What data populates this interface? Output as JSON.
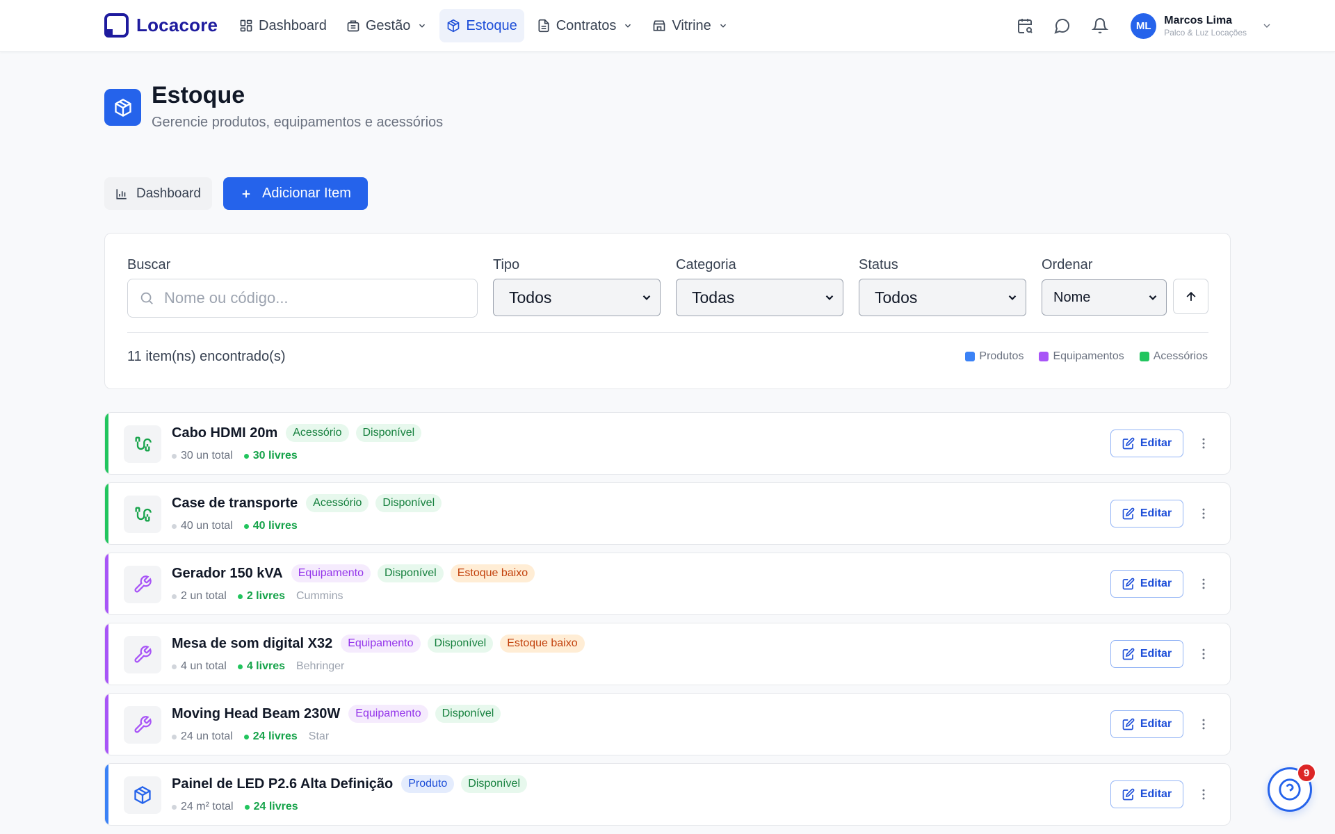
{
  "brand": {
    "name": "Locacore",
    "color": "#1e1b9e"
  },
  "nav": [
    {
      "label": "Dashboard",
      "icon": "grid-icon",
      "dropdown": false,
      "active": false
    },
    {
      "label": "Gestão",
      "icon": "building-icon",
      "dropdown": true,
      "active": false
    },
    {
      "label": "Estoque",
      "icon": "package-icon",
      "dropdown": false,
      "active": true
    },
    {
      "label": "Contratos",
      "icon": "file-icon",
      "dropdown": true,
      "active": false
    },
    {
      "label": "Vitrine",
      "icon": "store-icon",
      "dropdown": true,
      "active": false
    }
  ],
  "user": {
    "initials": "ML",
    "name": "Marcos Lima",
    "org": "Palco & Luz Locações"
  },
  "page": {
    "title": "Estoque",
    "subtitle": "Gerencie produtos, equipamentos e acessórios"
  },
  "actions": {
    "dashboard_label": "Dashboard",
    "add_label": "Adicionar Item"
  },
  "filters": {
    "search_label": "Buscar",
    "search_placeholder": "Nome ou código...",
    "type_label": "Tipo",
    "type_value": "Todos",
    "category_label": "Categoria",
    "category_value": "Todas",
    "status_label": "Status",
    "status_value": "Todos",
    "sort_label": "Ordenar",
    "sort_value": "Nome"
  },
  "results": {
    "count_text": "11 item(ns) encontrado(s)"
  },
  "legend": [
    {
      "label": "Produtos",
      "color": "#3b82f6"
    },
    {
      "label": "Equipamentos",
      "color": "#a855f7"
    },
    {
      "label": "Acessórios",
      "color": "#22c55e"
    }
  ],
  "items": [
    {
      "name": "Cabo HDMI 20m",
      "type": "Acessório",
      "status": "Disponível",
      "alert": "",
      "total": "30 un total",
      "free": "30 livres",
      "brand": "",
      "color": "#22c55e",
      "icon": "cable-icon"
    },
    {
      "name": "Case de transporte",
      "type": "Acessório",
      "status": "Disponível",
      "alert": "",
      "total": "40 un total",
      "free": "40 livres",
      "brand": "",
      "color": "#22c55e",
      "icon": "cable-icon"
    },
    {
      "name": "Gerador 150 kVA",
      "type": "Equipamento",
      "status": "Disponível",
      "alert": "Estoque baixo",
      "total": "2 un total",
      "free": "2 livres",
      "brand": "Cummins",
      "color": "#a855f7",
      "icon": "wrench-icon"
    },
    {
      "name": "Mesa de som digital X32",
      "type": "Equipamento",
      "status": "Disponível",
      "alert": "Estoque baixo",
      "total": "4 un total",
      "free": "4 livres",
      "brand": "Behringer",
      "color": "#a855f7",
      "icon": "wrench-icon"
    },
    {
      "name": "Moving Head Beam 230W",
      "type": "Equipamento",
      "status": "Disponível",
      "alert": "",
      "total": "24 un total",
      "free": "24 livres",
      "brand": "Star",
      "color": "#a855f7",
      "icon": "wrench-icon"
    },
    {
      "name": "Painel de LED P2.6 Alta Definição",
      "type": "Produto",
      "status": "Disponível",
      "alert": "",
      "total": "24 m² total",
      "free": "24 livres",
      "brand": "",
      "color": "#3b82f6",
      "icon": "package-icon"
    }
  ],
  "item_edit_label": "Editar",
  "help": {
    "badge_count": "9"
  }
}
